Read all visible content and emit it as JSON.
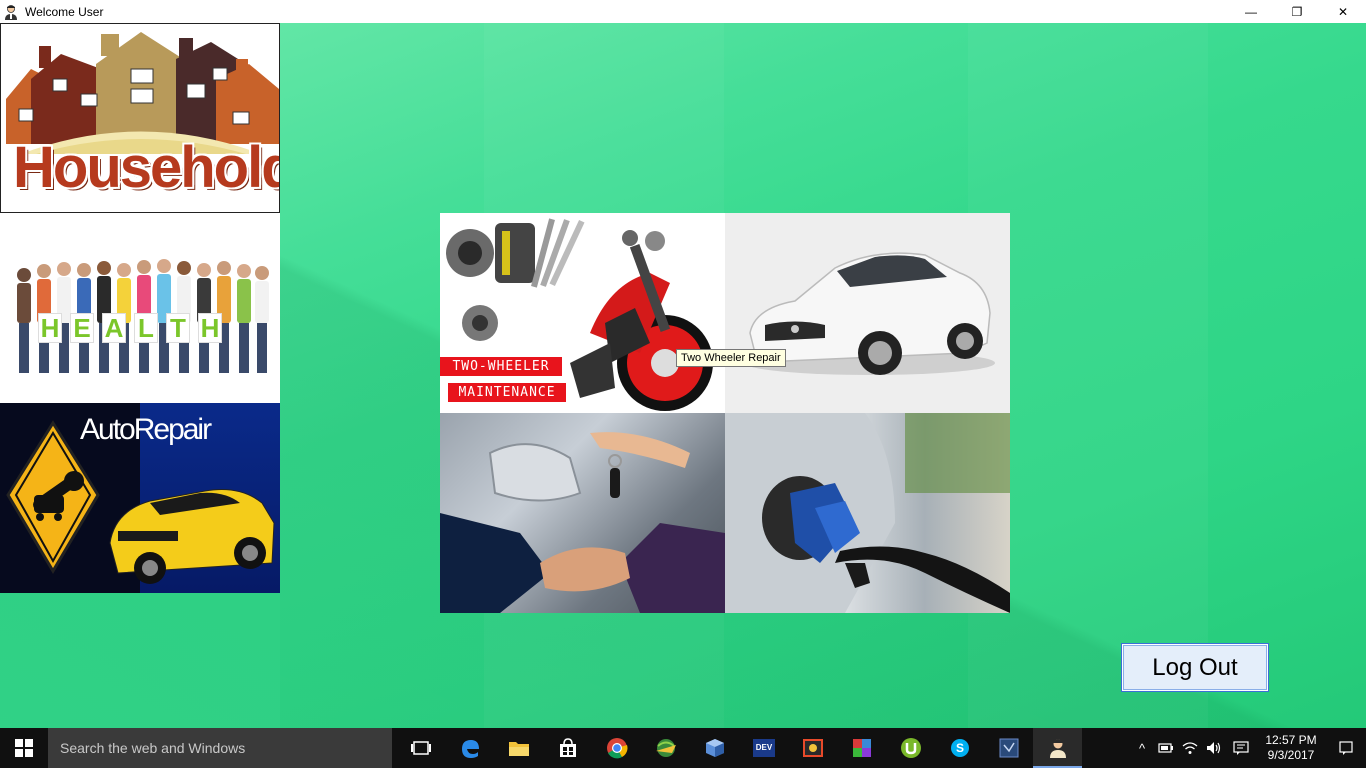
{
  "window": {
    "title": "Welcome User",
    "icon": "user-avatar-icon",
    "controls": {
      "minimize": "—",
      "restore": "❐",
      "close": "✕"
    }
  },
  "sidebar": {
    "tiles": [
      {
        "name": "household",
        "label": "Household"
      },
      {
        "name": "health",
        "letters": [
          "H",
          "E",
          "A",
          "L",
          "T",
          "H"
        ]
      },
      {
        "name": "autorepair",
        "label": "AutoRepair"
      }
    ]
  },
  "grid": {
    "moto_line1": "TWO-WHEELER",
    "moto_line2": "MAINTENANCE"
  },
  "tooltip": {
    "text": "Two Wheeler Repair"
  },
  "logout": {
    "label": "Log Out"
  },
  "taskbar": {
    "search_placeholder": "Search the web and Windows",
    "time": "12:57 PM",
    "date": "9/3/2017"
  },
  "colors": {
    "background": "#34d98c",
    "household_text": "#b63a1e",
    "health_letters": "#7bc62a",
    "moto_label_bg": "#e8141c",
    "logout_border": "#3b6fd6",
    "taskbar": "#101010"
  }
}
